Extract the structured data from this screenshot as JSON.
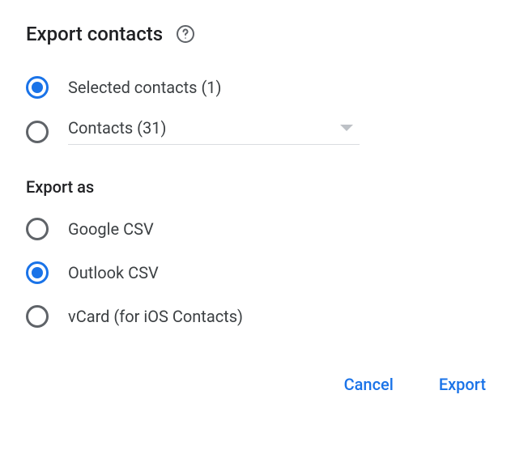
{
  "dialog": {
    "title": "Export contacts"
  },
  "source": {
    "options": [
      {
        "label": "Selected contacts (1)",
        "selected": true
      },
      {
        "label": "Contacts (31)",
        "selected": false,
        "dropdown": true
      }
    ]
  },
  "format": {
    "section_label": "Export as",
    "options": [
      {
        "label": "Google CSV",
        "selected": false
      },
      {
        "label": "Outlook CSV",
        "selected": true
      },
      {
        "label": "vCard (for iOS Contacts)",
        "selected": false
      }
    ]
  },
  "actions": {
    "cancel": "Cancel",
    "export": "Export"
  }
}
